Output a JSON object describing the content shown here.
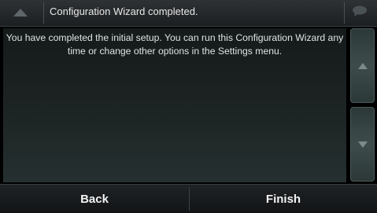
{
  "titlebar": {
    "title": "Configuration Wizard completed.",
    "left_icon": "triangle-up-icon",
    "right_icon": "speech-bubble-icon"
  },
  "content": {
    "message": "You have completed the initial setup. You can run this Configuration Wizard any time or change other options in the Settings menu."
  },
  "scroll": {
    "up_icon": "scroll-up-arrow-icon",
    "down_icon": "scroll-down-arrow-icon"
  },
  "footer": {
    "back_label": "Back",
    "finish_label": "Finish"
  },
  "colors": {
    "background": "#000000",
    "panel": "#1e2525",
    "text": "#dfe3e3",
    "scroll_button": "#3d4c4b"
  }
}
